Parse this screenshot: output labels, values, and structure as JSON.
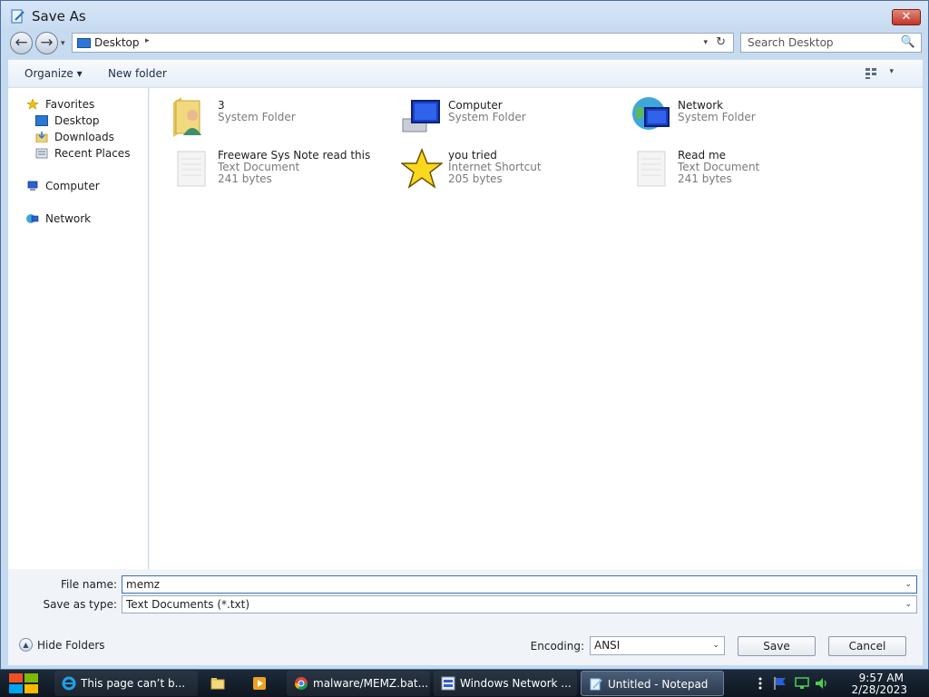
{
  "window": {
    "title": "Save As",
    "close_label": "✕"
  },
  "nav": {
    "back_glyph": "←",
    "forward_glyph": "→",
    "history_glyph": "▾",
    "address": "Desktop",
    "address_arrow": "▸",
    "dropdown_glyph": "▾",
    "refresh_glyph": "↻",
    "search_placeholder": "Search Desktop",
    "search_glyph": "🔍"
  },
  "toolbar": {
    "organize": "Organize ▾",
    "new_folder": "New folder",
    "view_dd": "▾"
  },
  "sidebar": {
    "favorites": "Favorites",
    "desktop": "Desktop",
    "downloads": "Downloads",
    "recent": "Recent Places",
    "computer": "Computer",
    "network": "Network"
  },
  "files": [
    {
      "name": "3",
      "type": "System Folder",
      "size": "",
      "icon": "user-folder-icon"
    },
    {
      "name": "Computer",
      "type": "System Folder",
      "size": "",
      "icon": "computer-icon"
    },
    {
      "name": "Network",
      "type": "System Folder",
      "size": "",
      "icon": "network-icon"
    },
    {
      "name": "Freeware Sys Note read this",
      "type": "Text Document",
      "size": "241 bytes",
      "icon": "text-document-icon"
    },
    {
      "name": "you tried",
      "type": "Internet Shortcut",
      "size": "205 bytes",
      "icon": "star-icon"
    },
    {
      "name": "Read me",
      "type": "Text Document",
      "size": "241 bytes",
      "icon": "text-document-icon"
    }
  ],
  "form": {
    "filename_label": "File name:",
    "filename_value": "memz",
    "savetype_label": "Save as type:",
    "savetype_value": "Text Documents (*.txt)",
    "dd_glyph": "⌄",
    "hide_folders": "Hide Folders",
    "hide_glyph": "▲",
    "encoding_label": "Encoding:",
    "encoding_value": "ANSI",
    "save_label": "Save",
    "cancel_label": "Cancel"
  },
  "taskbar": {
    "items": [
      {
        "label": "This page can’t b...",
        "icon": "ie-icon"
      },
      {
        "label": "",
        "icon": "explorer-icon"
      },
      {
        "label": "",
        "icon": "media-player-icon"
      },
      {
        "label": "malware/MEMZ.bat...",
        "icon": "chrome-icon"
      },
      {
        "label": "Windows Network ...",
        "icon": "network-window-icon"
      },
      {
        "label": "Untitled - Notepad",
        "icon": "notepad-icon"
      }
    ],
    "time": "9:57 AM",
    "date": "2/28/2023"
  },
  "colors": {
    "accent": "#2b78d4",
    "title_bg": "#c6daf0",
    "close": "#c2352a",
    "taskbar": "#0d1620"
  }
}
